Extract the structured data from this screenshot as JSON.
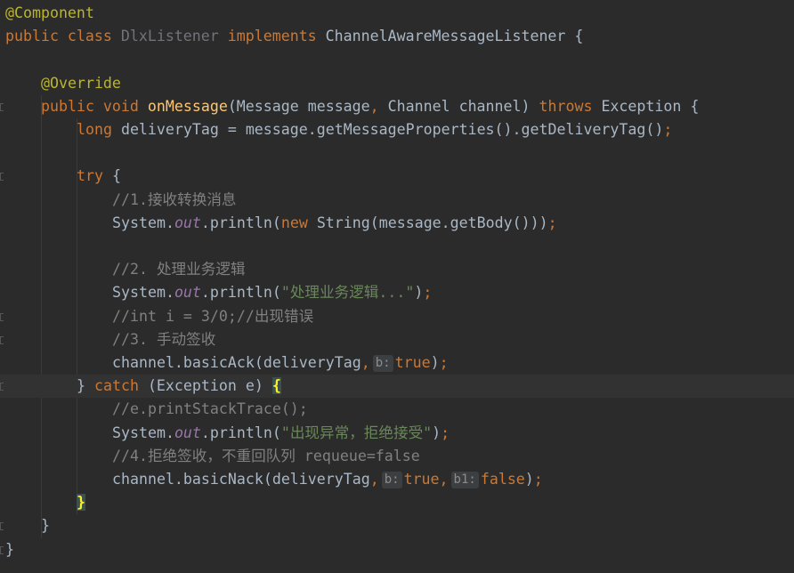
{
  "editor": {
    "theme": {
      "background": "#2b2b2b",
      "current_line": "#323232",
      "keyword": "#cc7832",
      "annotation": "#bbb529",
      "method_decl": "#ffc66d",
      "static_field": "#9876aa",
      "string": "#6a8759",
      "comment": "#808080",
      "plain": "#a9b7c6",
      "unused_class": "#72737a"
    },
    "lines": [
      {
        "indent": 0,
        "tokens": [
          {
            "t": "@Component",
            "k": "annotation"
          }
        ]
      },
      {
        "indent": 0,
        "tokens": [
          {
            "t": "public class ",
            "k": "keyword"
          },
          {
            "t": "DlxListener",
            "k": "unused_class"
          },
          {
            "t": " implements ",
            "k": "keyword"
          },
          {
            "t": "ChannelAwareMessageListener {",
            "k": "plain"
          }
        ]
      },
      {
        "indent": 0,
        "tokens": []
      },
      {
        "indent": 1,
        "tokens": [
          {
            "t": "@Override",
            "k": "annotation"
          }
        ]
      },
      {
        "indent": 1,
        "fold": true,
        "tokens": [
          {
            "t": "public void ",
            "k": "keyword"
          },
          {
            "t": "onMessage",
            "k": "method_decl"
          },
          {
            "t": "(Message message",
            "k": "plain"
          },
          {
            "t": ", ",
            "k": "keyword"
          },
          {
            "t": "Channel channel) ",
            "k": "plain"
          },
          {
            "t": "throws ",
            "k": "keyword"
          },
          {
            "t": "Exception {",
            "k": "plain"
          }
        ]
      },
      {
        "indent": 2,
        "tokens": [
          {
            "t": "long ",
            "k": "keyword"
          },
          {
            "t": "deliveryTag = message.getMessageProperties().getDeliveryTag()",
            "k": "plain"
          },
          {
            "t": ";",
            "k": "keyword"
          }
        ]
      },
      {
        "indent": 0,
        "tokens": []
      },
      {
        "indent": 2,
        "fold": true,
        "tokens": [
          {
            "t": "try ",
            "k": "keyword"
          },
          {
            "t": "{",
            "k": "plain"
          }
        ]
      },
      {
        "indent": 3,
        "tokens": [
          {
            "t": "//1.接收转换消息",
            "k": "comment"
          }
        ]
      },
      {
        "indent": 3,
        "tokens": [
          {
            "t": "System.",
            "k": "plain"
          },
          {
            "t": "out",
            "k": "static_field"
          },
          {
            "t": ".println(",
            "k": "plain"
          },
          {
            "t": "new ",
            "k": "keyword"
          },
          {
            "t": "String(message.getBody()))",
            "k": "plain"
          },
          {
            "t": ";",
            "k": "keyword"
          }
        ]
      },
      {
        "indent": 0,
        "tokens": []
      },
      {
        "indent": 3,
        "tokens": [
          {
            "t": "//2. 处理业务逻辑",
            "k": "comment"
          }
        ]
      },
      {
        "indent": 3,
        "tokens": [
          {
            "t": "System.",
            "k": "plain"
          },
          {
            "t": "out",
            "k": "static_field"
          },
          {
            "t": ".println(",
            "k": "plain"
          },
          {
            "t": "\"处理业务逻辑...\"",
            "k": "string"
          },
          {
            "t": ")",
            "k": "plain"
          },
          {
            "t": ";",
            "k": "keyword"
          }
        ]
      },
      {
        "indent": 3,
        "fold": true,
        "tokens": [
          {
            "t": "//int i = 3/0;//出现错误",
            "k": "comment"
          }
        ]
      },
      {
        "indent": 3,
        "fold": true,
        "tokens": [
          {
            "t": "//3. 手动签收",
            "k": "comment"
          }
        ]
      },
      {
        "indent": 3,
        "tokens": [
          {
            "t": "channel.basicAck(deliveryTag",
            "k": "plain"
          },
          {
            "t": ",",
            "k": "keyword"
          },
          {
            "hint": "b:"
          },
          {
            "t": "true",
            "k": "keyword"
          },
          {
            "t": ")",
            "k": "plain"
          },
          {
            "t": ";",
            "k": "keyword"
          }
        ]
      },
      {
        "indent": 2,
        "current": true,
        "fold": true,
        "tokens": [
          {
            "t": "} ",
            "k": "plain"
          },
          {
            "t": "catch ",
            "k": "keyword"
          },
          {
            "t": "(Exception e) ",
            "k": "plain"
          },
          {
            "t": "{",
            "k": "brace"
          }
        ]
      },
      {
        "indent": 3,
        "tokens": [
          {
            "t": "//e.printStackTrace();",
            "k": "comment"
          }
        ]
      },
      {
        "indent": 3,
        "tokens": [
          {
            "t": "System.",
            "k": "plain"
          },
          {
            "t": "out",
            "k": "static_field"
          },
          {
            "t": ".println(",
            "k": "plain"
          },
          {
            "t": "\"出现异常，拒绝接受\"",
            "k": "string"
          },
          {
            "t": ")",
            "k": "plain"
          },
          {
            "t": ";",
            "k": "keyword"
          }
        ]
      },
      {
        "indent": 3,
        "tokens": [
          {
            "t": "//4.拒绝签收，不重回队列 requeue=false",
            "k": "comment"
          }
        ]
      },
      {
        "indent": 3,
        "tokens": [
          {
            "t": "channel.basicNack(deliveryTag",
            "k": "plain"
          },
          {
            "t": ",",
            "k": "keyword"
          },
          {
            "hint": "b:"
          },
          {
            "t": "true",
            "k": "keyword"
          },
          {
            "t": ",",
            "k": "keyword"
          },
          {
            "hint": "b1:"
          },
          {
            "t": "false",
            "k": "keyword"
          },
          {
            "t": ")",
            "k": "plain"
          },
          {
            "t": ";",
            "k": "keyword"
          }
        ]
      },
      {
        "indent": 2,
        "tokens": [
          {
            "t": "}",
            "k": "brace"
          }
        ]
      },
      {
        "indent": 1,
        "fold": true,
        "tokens": [
          {
            "t": "}",
            "k": "plain"
          }
        ]
      },
      {
        "indent": 0,
        "fold": true,
        "tokens": [
          {
            "t": "}",
            "k": "plain"
          }
        ]
      }
    ]
  }
}
